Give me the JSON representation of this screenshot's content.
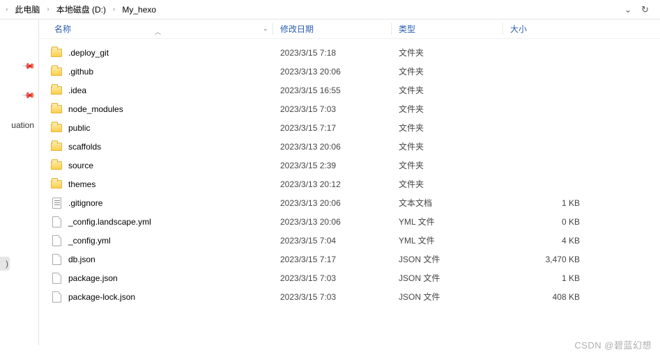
{
  "breadcrumb": {
    "items": [
      {
        "label": "此电脑"
      },
      {
        "label": "本地磁盘 (D:)"
      },
      {
        "label": "My_hexo"
      }
    ]
  },
  "sidebar": {
    "label_fragment": "uation",
    "paren": ")"
  },
  "columns": {
    "name": "名称",
    "date": "修改日期",
    "type": "类型",
    "size": "大小"
  },
  "files": [
    {
      "icon": "folder",
      "name": ".deploy_git",
      "date": "2023/3/15 7:18",
      "type": "文件夹",
      "size": ""
    },
    {
      "icon": "folder",
      "name": ".github",
      "date": "2023/3/13 20:06",
      "type": "文件夹",
      "size": ""
    },
    {
      "icon": "folder",
      "name": ".idea",
      "date": "2023/3/15 16:55",
      "type": "文件夹",
      "size": ""
    },
    {
      "icon": "folder",
      "name": "node_modules",
      "date": "2023/3/15 7:03",
      "type": "文件夹",
      "size": ""
    },
    {
      "icon": "folder",
      "name": "public",
      "date": "2023/3/15 7:17",
      "type": "文件夹",
      "size": ""
    },
    {
      "icon": "folder",
      "name": "scaffolds",
      "date": "2023/3/13 20:06",
      "type": "文件夹",
      "size": ""
    },
    {
      "icon": "folder",
      "name": "source",
      "date": "2023/3/15 2:39",
      "type": "文件夹",
      "size": ""
    },
    {
      "icon": "folder",
      "name": "themes",
      "date": "2023/3/13 20:12",
      "type": "文件夹",
      "size": ""
    },
    {
      "icon": "text",
      "name": ".gitignore",
      "date": "2023/3/13 20:06",
      "type": "文本文档",
      "size": "1 KB"
    },
    {
      "icon": "file",
      "name": "_config.landscape.yml",
      "date": "2023/3/13 20:06",
      "type": "YML 文件",
      "size": "0 KB"
    },
    {
      "icon": "file",
      "name": "_config.yml",
      "date": "2023/3/15 7:04",
      "type": "YML 文件",
      "size": "4 KB"
    },
    {
      "icon": "file",
      "name": "db.json",
      "date": "2023/3/15 7:17",
      "type": "JSON 文件",
      "size": "3,470 KB"
    },
    {
      "icon": "file",
      "name": "package.json",
      "date": "2023/3/15 7:03",
      "type": "JSON 文件",
      "size": "1 KB"
    },
    {
      "icon": "file",
      "name": "package-lock.json",
      "date": "2023/3/15 7:03",
      "type": "JSON 文件",
      "size": "408 KB"
    }
  ],
  "watermark": "CSDN @碧蓝幻想"
}
